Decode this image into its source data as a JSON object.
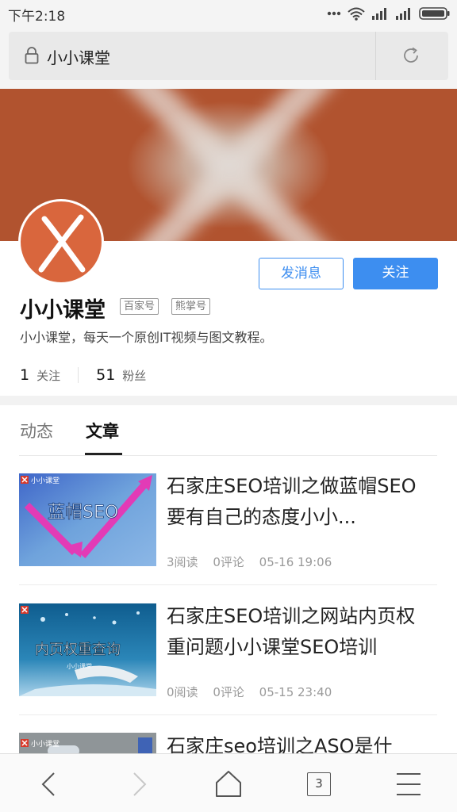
{
  "status_bar": {
    "time": "下午2:18",
    "icons": [
      "dots-icon",
      "wifi-icon",
      "signal-icon",
      "signal-icon",
      "battery-icon"
    ]
  },
  "address_bar": {
    "text": "小小课堂",
    "icons": [
      "lock-icon",
      "reload-icon"
    ]
  },
  "profile": {
    "name": "小小课堂",
    "tags": [
      "百家号",
      "熊掌号"
    ],
    "description": "小小课堂，每天一个原创IT视频与图文教程。",
    "stats": [
      {
        "value": "1",
        "label": "关注"
      },
      {
        "value": "51",
        "label": "粉丝"
      }
    ],
    "buttons": {
      "message": "发消息",
      "follow": "关注"
    }
  },
  "tabs": [
    {
      "label": "动态",
      "active": false
    },
    {
      "label": "文章",
      "active": true
    }
  ],
  "articles": [
    {
      "title": "石家庄SEO培训之做蓝帽SEO要有自己的态度小小...",
      "reads": "3阅读",
      "comments": "0评论",
      "date": "05-16 19:06",
      "thumb_brand": "小小课堂",
      "thumb_text": "蓝帽SEO"
    },
    {
      "title": "石家庄SEO培训之网站内页权重问题小小课堂SEO培训",
      "reads": "0阅读",
      "comments": "0评论",
      "date": "05-15 23:40",
      "thumb_brand": "小小课堂",
      "thumb_text": "内页权重查询"
    },
    {
      "title": "石家庄seo培训之ASO是什",
      "thumb_brand": "小小课堂"
    }
  ],
  "bottom_nav": {
    "tab_count": "3",
    "icons": [
      "back-icon",
      "forward-icon",
      "home-icon",
      "tabs-icon",
      "menu-icon"
    ]
  },
  "colors": {
    "accent": "#3d8ef0",
    "banner": "#b1532f",
    "avatar": "#d9663d"
  }
}
